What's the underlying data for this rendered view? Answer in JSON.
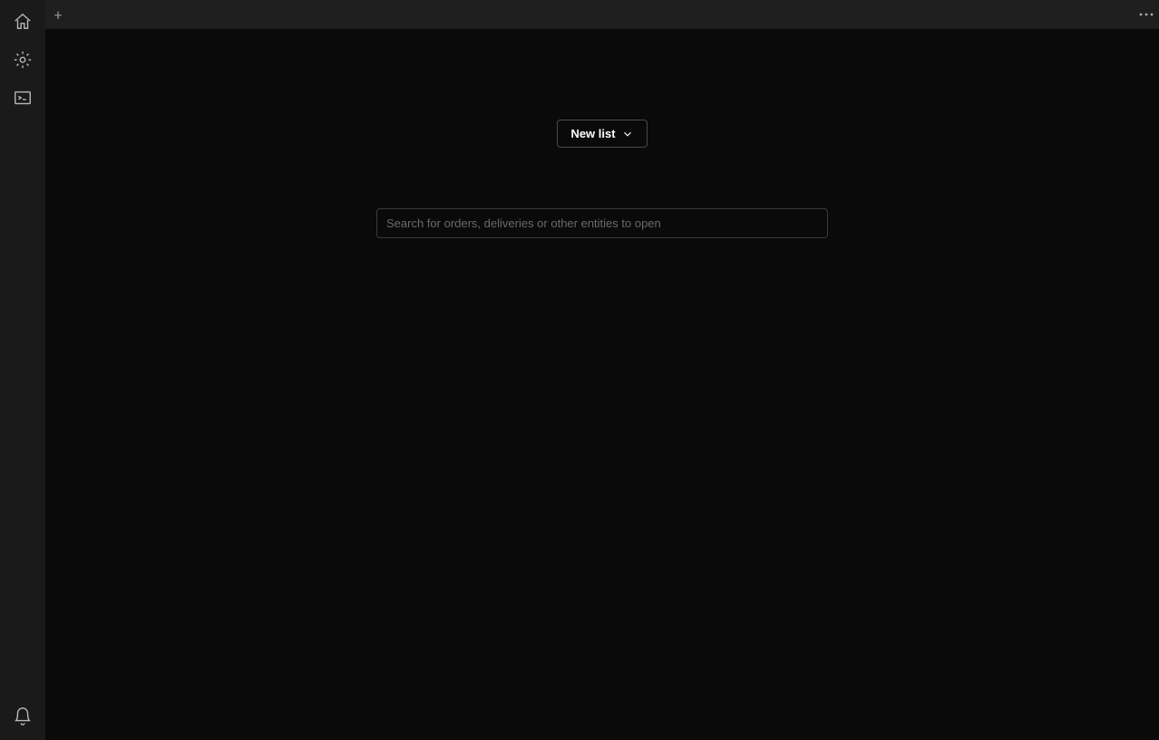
{
  "tabbar": {
    "new_tab_label": "+"
  },
  "main": {
    "newlist_label": "New list",
    "search_placeholder": "Search for orders, deliveries or other entities to open",
    "search_value": ""
  }
}
